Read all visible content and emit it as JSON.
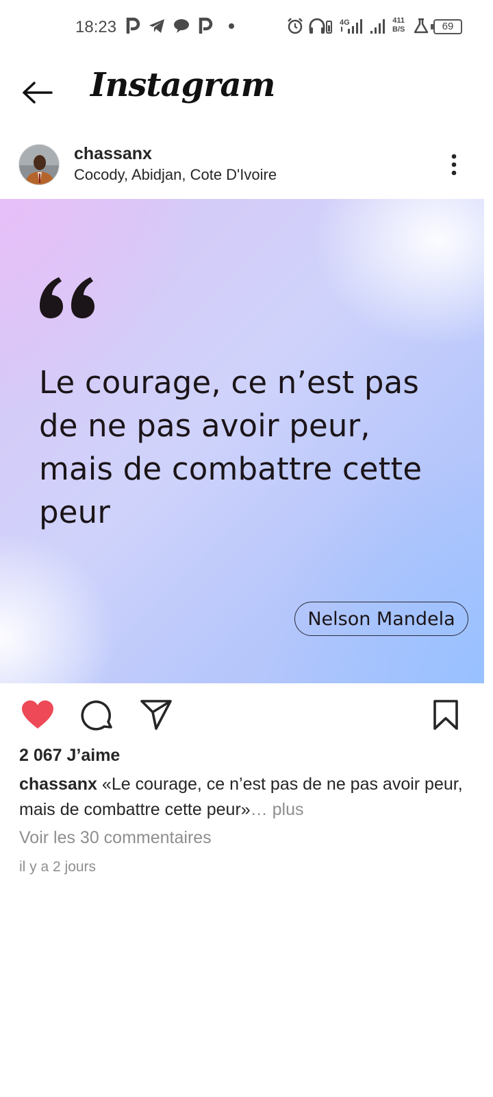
{
  "status_bar": {
    "time": "18:23",
    "icons": [
      "parking-icon",
      "telegram-icon",
      "chat-bubble-icon",
      "parking-icon",
      "dot-icon",
      "alarm-icon",
      "headphones-icon",
      "signal-4g-icon",
      "signal-icon",
      "lab-flask-icon"
    ],
    "net_speed_value": "411",
    "net_speed_unit": "B/S",
    "battery": "69"
  },
  "header": {
    "title": "Instagram"
  },
  "post": {
    "username": "chassanx",
    "location": "Cocody, Abidjan, Cote D'Ivoire",
    "image": {
      "quote": "Le courage, ce n’est pas de ne pas avoir peur, mais de combattre cette peur",
      "author": "Nelson Mandela",
      "gradient_colors": [
        "#e7c0f8",
        "#cfd3fb",
        "#99c1ff"
      ]
    },
    "liked": true,
    "like_color": "#ed4956",
    "likes": "2 067 J’aime",
    "caption_user": "chassanx",
    "caption_text": " «Le courage, ce n’est pas de ne pas avoir peur, mais de combattre cette peur»",
    "caption_ellipsis": "… ",
    "caption_more": "plus",
    "comments_link": "Voir les 30 commentaires",
    "timestamp": "il y a 2 jours"
  }
}
